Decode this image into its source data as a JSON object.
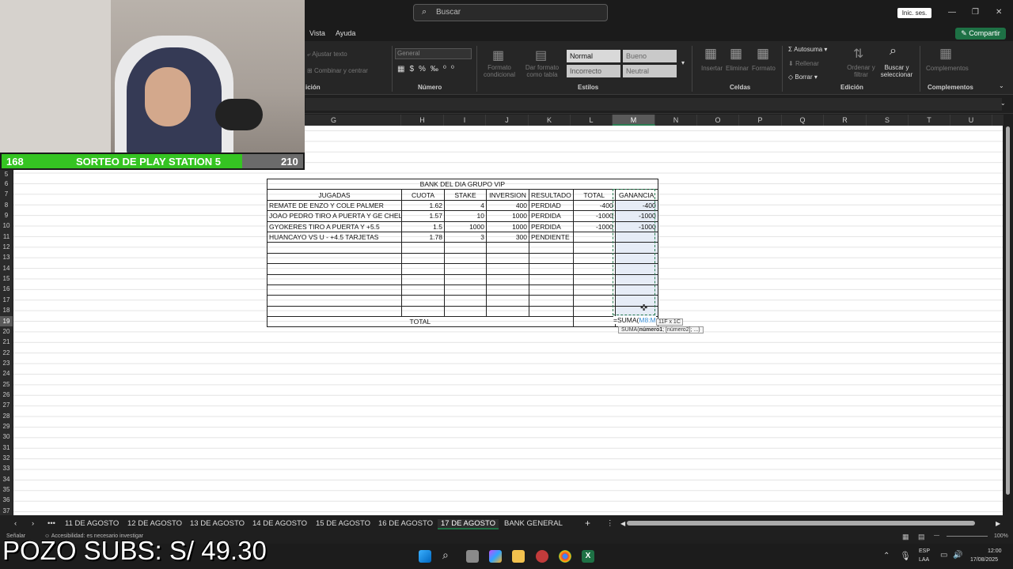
{
  "titlebar": {
    "search_placeholder": "Buscar",
    "login_button": "Inic. ses."
  },
  "menu": {
    "items": [
      "Vista",
      "Ayuda"
    ],
    "share_button": "Compartir"
  },
  "ribbon": {
    "wrap_text": "Ajustar texto",
    "merge_center": "Combinar y centrar",
    "alignment_group": "ición",
    "number_format": "General",
    "number_group": "Número",
    "conditional_format": "Formato condicional",
    "format_as_table": "Dar formato como tabla",
    "styles": [
      "Normal",
      "Bueno",
      "Incorrecto",
      "Neutral"
    ],
    "styles_group": "Estilos",
    "insert": "Insertar",
    "delete": "Eliminar",
    "format": "Formato",
    "cells_group": "Celdas",
    "autosum": "Autosuma",
    "fill": "Rellenar",
    "clear": "Borrar",
    "sort_filter": "Ordenar y filtrar",
    "find_select": "Buscar y seleccionar",
    "editing_group": "Edición",
    "addins": "Complementos",
    "addins_group": "Complementos"
  },
  "columns": [
    "G",
    "H",
    "I",
    "J",
    "K",
    "L",
    "M",
    "N",
    "O",
    "P",
    "Q",
    "R",
    "S",
    "T",
    "U"
  ],
  "rows": [
    "5",
    "6",
    "7",
    "8",
    "9",
    "10",
    "11",
    "12",
    "13",
    "14",
    "15",
    "16",
    "17",
    "18",
    "19",
    "20",
    "21",
    "22",
    "23",
    "24",
    "25",
    "26",
    "27",
    "28",
    "29",
    "30",
    "31",
    "32",
    "33",
    "34",
    "35",
    "36",
    "37"
  ],
  "bank": {
    "title": "BANK DEL DIA GRUPO VIP",
    "headers": [
      "JUGADAS",
      "CUOTA",
      "STAKE",
      "INVERSION",
      "RESULTADO",
      "TOTAL",
      "GANANCIA"
    ],
    "rows": [
      [
        "REMATE DE ENZO Y COLE PALMER",
        "1.62",
        "4",
        "400",
        "PERDIAD",
        "-400",
        "-400"
      ],
      [
        "JOAO PEDRO TIRO A PUERTA Y GE CHELSEA",
        "1.57",
        "10",
        "1000",
        "PERDIDA",
        "-1000",
        "-1000"
      ],
      [
        "GYOKERES TIRO A PUERTA Y +5.5",
        "1.5",
        "1000",
        "1000",
        "PERDIDA",
        "-1000",
        "-1000"
      ],
      [
        "HUANCAYO VS U - +4.5 TARJETAS",
        "1.78",
        "3",
        "300",
        "PENDIENTE",
        "",
        ""
      ],
      [
        "",
        "",
        "",
        "",
        "",
        "",
        ""
      ],
      [
        "",
        "",
        "",
        "",
        "",
        "",
        ""
      ],
      [
        "",
        "",
        "",
        "",
        "",
        "",
        ""
      ],
      [
        "",
        "",
        "",
        "",
        "",
        "",
        ""
      ],
      [
        "",
        "",
        "",
        "",
        "",
        "",
        ""
      ],
      [
        "",
        "",
        "",
        "",
        "",
        "",
        ""
      ],
      [
        "",
        "",
        "",
        "",
        "",
        "",
        ""
      ]
    ],
    "total_label": "TOTAL",
    "formula_prefix": "=SUMA(",
    "formula_ref": "M8:M",
    "size_tip": "11F x 1C",
    "function_tip_prefix": "SUMA(",
    "function_tip_bold": "número1",
    "function_tip_suffix": "; [número2]; ...)"
  },
  "tabs": {
    "items": [
      "11 DE AGOSTO",
      "12 DE AGOSTO",
      "13 DE AGOSTO",
      "14 DE AGOSTO",
      "15 DE AGOSTO",
      "16 DE AGOSTO",
      "17 DE AGOSTO",
      "BANK GENERAL"
    ],
    "active": "17 DE AGOSTO"
  },
  "statusbar": {
    "left": "Señalar",
    "accessibility": "Accesibilidad: es necesario investigar",
    "zoom": "100%"
  },
  "taskbar": {
    "lang": "ESP",
    "region": "LAA",
    "time": "12:00",
    "date": "17/08/2025"
  },
  "overlay": {
    "left_count": "168",
    "banner": "SORTEO DE PLAY STATION 5",
    "right_count": "210",
    "pozo": "POZO SUBS: S/ 49.30"
  }
}
